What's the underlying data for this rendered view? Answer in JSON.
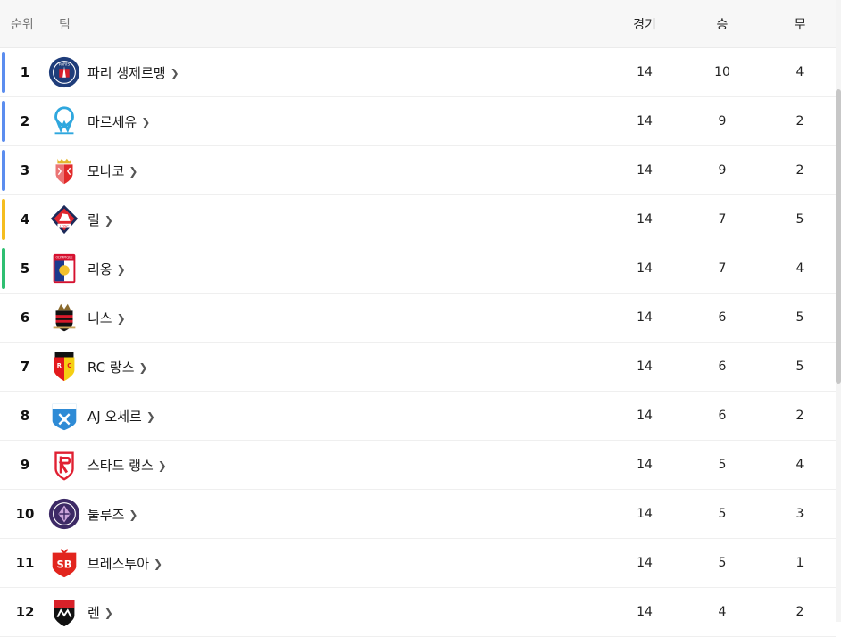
{
  "header": {
    "rank": "순위",
    "team": "팀",
    "played": "경기",
    "won": "승",
    "drawn": "무"
  },
  "colors": {
    "ucl": "#5b8def",
    "uel": "#f5bd1f",
    "uecl": "#2fbf71"
  },
  "rows": [
    {
      "rank": "1",
      "team": "파리 생제르맹",
      "played": "14",
      "won": "10",
      "drawn": "4",
      "zone": "ucl",
      "logo": "psg"
    },
    {
      "rank": "2",
      "team": "마르세유",
      "played": "14",
      "won": "9",
      "drawn": "2",
      "zone": "ucl",
      "logo": "om"
    },
    {
      "rank": "3",
      "team": "모나코",
      "played": "14",
      "won": "9",
      "drawn": "2",
      "zone": "ucl",
      "logo": "monaco"
    },
    {
      "rank": "4",
      "team": "릴",
      "played": "14",
      "won": "7",
      "drawn": "5",
      "zone": "uel",
      "logo": "lille"
    },
    {
      "rank": "5",
      "team": "리옹",
      "played": "14",
      "won": "7",
      "drawn": "4",
      "zone": "uecl",
      "logo": "lyon"
    },
    {
      "rank": "6",
      "team": "니스",
      "played": "14",
      "won": "6",
      "drawn": "5",
      "zone": "",
      "logo": "nice"
    },
    {
      "rank": "7",
      "team": "RC 랑스",
      "played": "14",
      "won": "6",
      "drawn": "5",
      "zone": "",
      "logo": "lens"
    },
    {
      "rank": "8",
      "team": "AJ 오세르",
      "played": "14",
      "won": "6",
      "drawn": "2",
      "zone": "",
      "logo": "auxerre"
    },
    {
      "rank": "9",
      "team": "스타드 랭스",
      "played": "14",
      "won": "5",
      "drawn": "4",
      "zone": "",
      "logo": "reims"
    },
    {
      "rank": "10",
      "team": "툴루즈",
      "played": "14",
      "won": "5",
      "drawn": "3",
      "zone": "",
      "logo": "toulouse"
    },
    {
      "rank": "11",
      "team": "브레스투아",
      "played": "14",
      "won": "5",
      "drawn": "1",
      "zone": "",
      "logo": "brest"
    },
    {
      "rank": "12",
      "team": "렌",
      "played": "14",
      "won": "4",
      "drawn": "2",
      "zone": "",
      "logo": "rennes"
    }
  ]
}
